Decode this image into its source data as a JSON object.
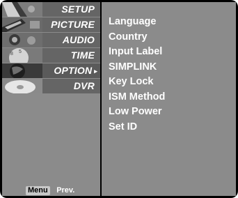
{
  "menu": {
    "items": [
      {
        "label": "SETUP",
        "icon": "setup-thumbnail-icon",
        "selected": false
      },
      {
        "label": "PICTURE",
        "icon": "picture-thumbnail-icon",
        "selected": false
      },
      {
        "label": "AUDIO",
        "icon": "audio-thumbnail-icon",
        "selected": false
      },
      {
        "label": "TIME",
        "icon": "time-thumbnail-icon",
        "selected": false
      },
      {
        "label": "OPTION",
        "icon": "option-thumbnail-icon",
        "selected": true
      },
      {
        "label": "DVR",
        "icon": "dvr-thumbnail-icon",
        "selected": false
      }
    ],
    "arrow": "▸"
  },
  "submenu": {
    "items": [
      "Language",
      "Country",
      "Input Label",
      "SIMPLINK",
      "Key Lock",
      "ISM Method",
      "Low Power",
      "Set ID"
    ]
  },
  "hints": {
    "menu_key": "Menu",
    "prev": "Prev."
  },
  "colors": {
    "panel": "#8b8b8b",
    "item": "#656565",
    "frame": "#000000",
    "text": "#ffffff"
  }
}
